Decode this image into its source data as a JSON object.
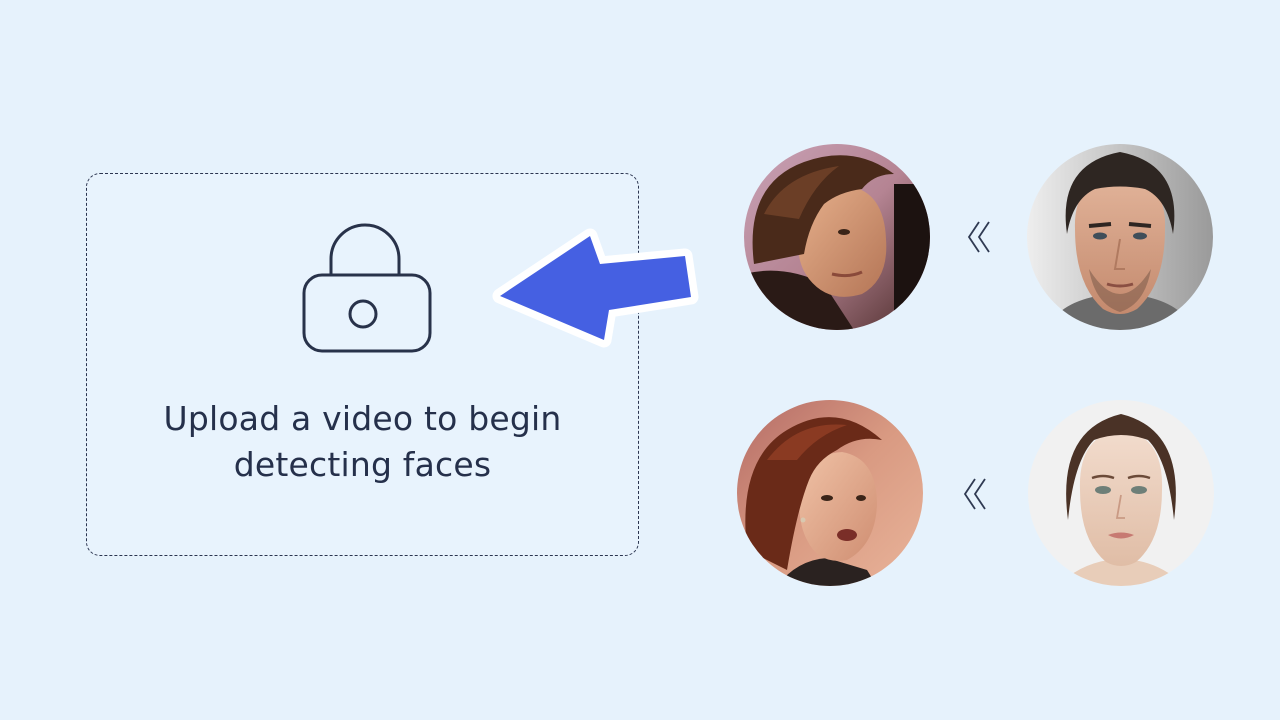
{
  "upload": {
    "line1": "Upload a video to begin",
    "line2": "detecting faces",
    "icon": "lock-icon"
  },
  "arrow": {
    "icon": "arrow-left-icon",
    "color": "#4560e2",
    "outline_color": "#ffffff"
  },
  "face_pairs": [
    {
      "detected": "detected-face-man",
      "replacement": "replacement-face-man",
      "swap_icon": "double-chevron-left-icon"
    },
    {
      "detected": "detected-face-woman",
      "replacement": "replacement-face-woman",
      "swap_icon": "double-chevron-left-icon"
    }
  ],
  "colors": {
    "background": "#e6f2fc",
    "text": "#25304b",
    "accent": "#4560e2"
  }
}
